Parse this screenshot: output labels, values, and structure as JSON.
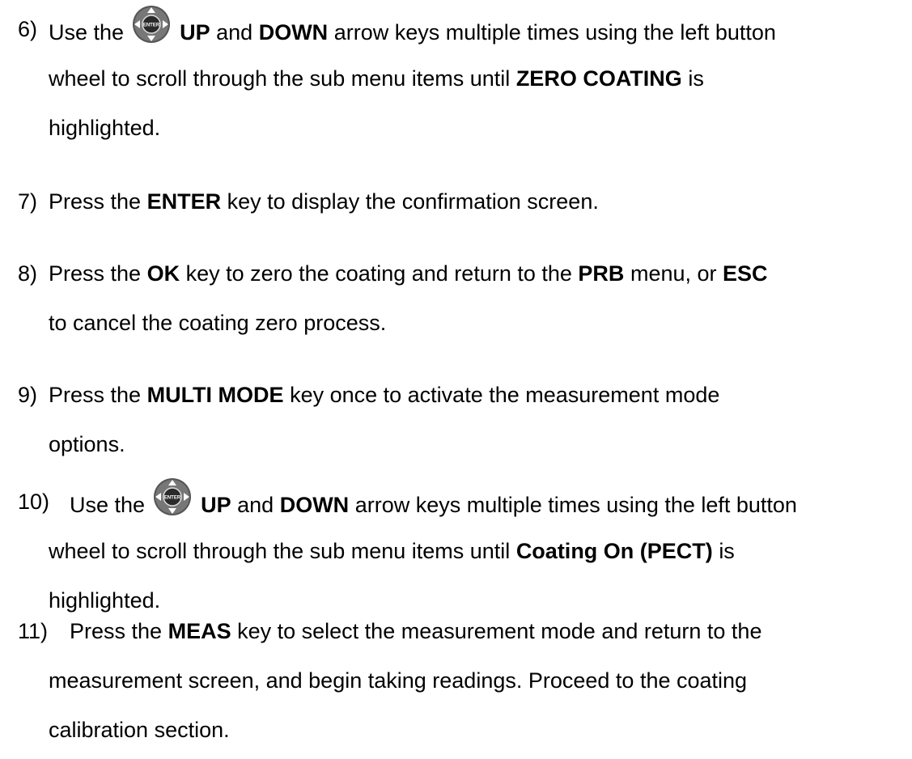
{
  "steps": [
    {
      "number": "6)",
      "lines": [
        {
          "a": "Use the",
          "b": "UP",
          "c": "and",
          "d": "DOWN",
          "e": "arrow keys multiple times using the left button"
        },
        {
          "a": "wheel to scroll through the sub menu items until",
          "b": "ZERO COATING",
          "c": "is"
        },
        {
          "a": "highlighted."
        }
      ],
      "icon": "dpad-enter-icon"
    },
    {
      "number": "7)",
      "lines": [
        {
          "a": "Press the",
          "b": "ENTER",
          "c": "key to display the confirmation screen."
        }
      ]
    },
    {
      "number": "8)",
      "lines": [
        {
          "a": "Press the",
          "b": "OK",
          "c": "key to zero the coating and return to the",
          "d": "PRB",
          "e": "menu, or",
          "f": "ESC"
        },
        {
          "a": "to cancel the coating zero process."
        }
      ]
    },
    {
      "number": "9)",
      "lines": [
        {
          "a": "Press the",
          "b": "MULTI MODE",
          "c": "key once to activate the measurement mode"
        },
        {
          "a": "options."
        }
      ]
    },
    {
      "number": "10)",
      "lines": [
        {
          "a": "Use the",
          "b": "UP",
          "c": "and",
          "d": "DOWN",
          "e": "arrow keys multiple times using the left button"
        },
        {
          "a": "wheel to scroll through the sub menu items until",
          "b": "Coating On (PECT)",
          "c": "is"
        },
        {
          "a": "highlighted."
        }
      ],
      "icon": "dpad-enter-icon"
    },
    {
      "number": "11)",
      "lines": [
        {
          "a": "Press the",
          "b": "MEAS",
          "c": "key to select the measurement mode and return to the"
        },
        {
          "a": "measurement screen, and begin taking readings.  Proceed to the coating"
        },
        {
          "a": "calibration section."
        }
      ]
    }
  ],
  "icon_label": "ENTER",
  "colors": {
    "text": "#000000",
    "icon_body": "#555555",
    "icon_dark": "#2a2a2a"
  }
}
